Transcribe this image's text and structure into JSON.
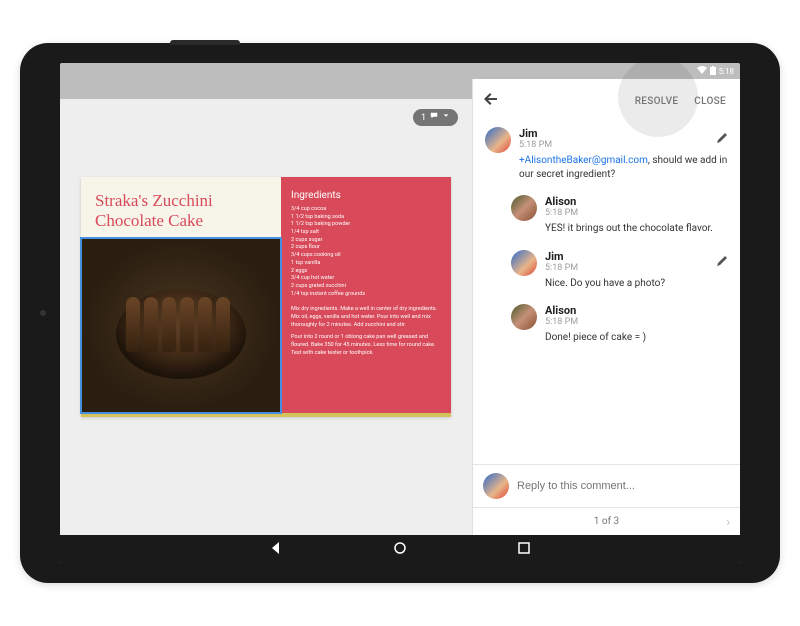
{
  "status": {
    "time": "5:18"
  },
  "comment_pill": {
    "count": "1"
  },
  "slide": {
    "title_line1": "Straka's Zucchini",
    "title_line2": "Chocolate Cake",
    "ingredients_heading": "Ingredients",
    "ingredients": [
      "3/4 cup cocoa",
      "1 1/2 tsp baking soda",
      "1 1/2 tsp baking powder",
      "1/4 tsp salt",
      "2 cups sugar",
      "2 cups flour",
      "3/4 cups cooking oil",
      "1 tsp vanilla",
      "2 eggs",
      "3/4 cup hot water",
      "2 cups grated zucchini",
      "1/4 tsp instant coffee grounds"
    ],
    "instructions": [
      "Mix dry ingredients. Make a well in center of dry ingredients. Mix oil, eggs, vanilla and hot water. Pour into well and mix thoroughly for 2 minutes. Add zucchini and stir.",
      "Pour into 2 round or 1 oblong cake pan well greased and floured. Bake 350 for 45 minutes. Less time for round cake. Test with cake tester or toothpick."
    ]
  },
  "panel": {
    "resolve_label": "RESOLVE",
    "close_label": "CLOSE"
  },
  "comments": [
    {
      "author": "Jim",
      "time": "5:18 PM",
      "mention": "+AlisontheBaker@gmail.com",
      "text": ", should we add in our secret ingredient?",
      "is_owner": true
    },
    {
      "author": "Alison",
      "time": "5:18 PM",
      "text": "YES! it brings out the chocolate flavor.",
      "is_owner": false
    },
    {
      "author": "Jim",
      "time": "5:18 PM",
      "text": "Nice. Do you have a photo?",
      "is_owner": true
    },
    {
      "author": "Alison",
      "time": "5:18 PM",
      "text": "Done! piece of cake = )",
      "is_owner": false
    }
  ],
  "reply": {
    "placeholder": "Reply to this comment..."
  },
  "pager": {
    "label": "1 of 3"
  }
}
